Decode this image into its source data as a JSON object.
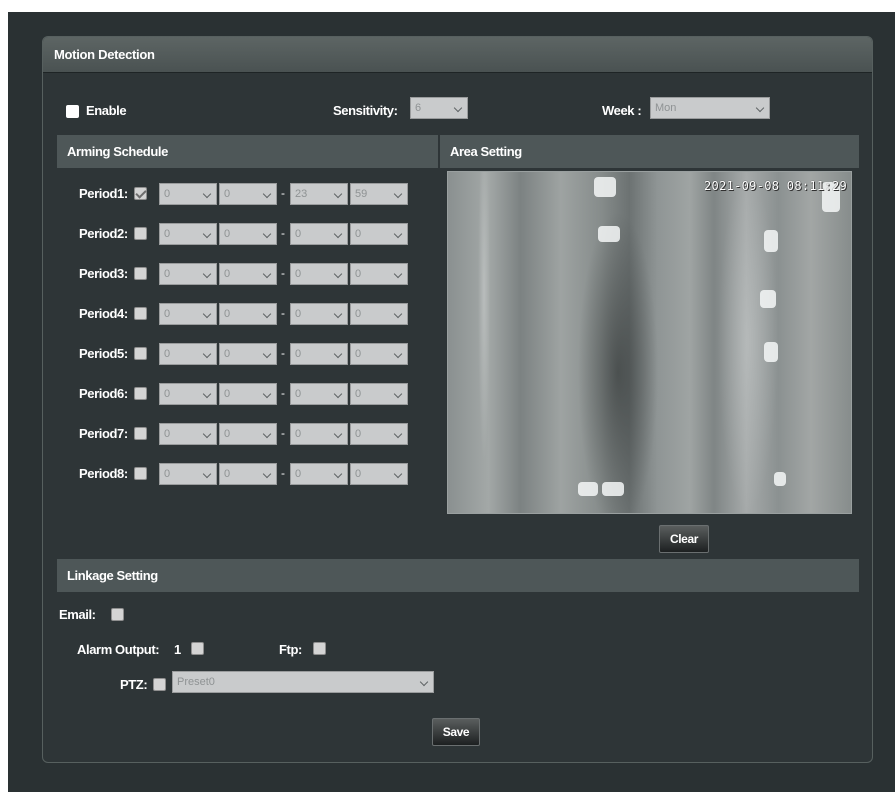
{
  "panel_title": "Motion Detection",
  "enable": {
    "label": "Enable",
    "checked": false
  },
  "sensitivity": {
    "label": "Sensitivity:",
    "value": "6"
  },
  "week": {
    "label": "Week :",
    "value": "Mon"
  },
  "arming_schedule": {
    "title": "Arming Schedule",
    "dash": "-",
    "periods": [
      {
        "label": "Period1:",
        "checked": true,
        "start_hour": "0",
        "start_min": "0",
        "end_hour": "23",
        "end_min": "59"
      },
      {
        "label": "Period2:",
        "checked": false,
        "start_hour": "0",
        "start_min": "0",
        "end_hour": "0",
        "end_min": "0"
      },
      {
        "label": "Period3:",
        "checked": false,
        "start_hour": "0",
        "start_min": "0",
        "end_hour": "0",
        "end_min": "0"
      },
      {
        "label": "Period4:",
        "checked": false,
        "start_hour": "0",
        "start_min": "0",
        "end_hour": "0",
        "end_min": "0"
      },
      {
        "label": "Period5:",
        "checked": false,
        "start_hour": "0",
        "start_min": "0",
        "end_hour": "0",
        "end_min": "0"
      },
      {
        "label": "Period6:",
        "checked": false,
        "start_hour": "0",
        "start_min": "0",
        "end_hour": "0",
        "end_min": "0"
      },
      {
        "label": "Period7:",
        "checked": false,
        "start_hour": "0",
        "start_min": "0",
        "end_hour": "0",
        "end_min": "0"
      },
      {
        "label": "Period8:",
        "checked": false,
        "start_hour": "0",
        "start_min": "0",
        "end_hour": "0",
        "end_min": "0"
      }
    ]
  },
  "area_setting": {
    "title": "Area Setting",
    "timestamp": "2021-09-08 08:11:29",
    "clear_button": "Clear"
  },
  "linkage": {
    "title": "Linkage Setting",
    "email_label": "Email:",
    "alarm_output_label": "Alarm Output:",
    "alarm_output_number": "1",
    "ftp_label": "Ftp:",
    "ptz_label": "PTZ:",
    "ptz_preset": "Preset0"
  },
  "save_button": "Save",
  "colors": {
    "background": "#2a3133",
    "panel_header": "#5d6564",
    "section_bar": "#4e5758",
    "select_bg": "#c9cbcc"
  }
}
